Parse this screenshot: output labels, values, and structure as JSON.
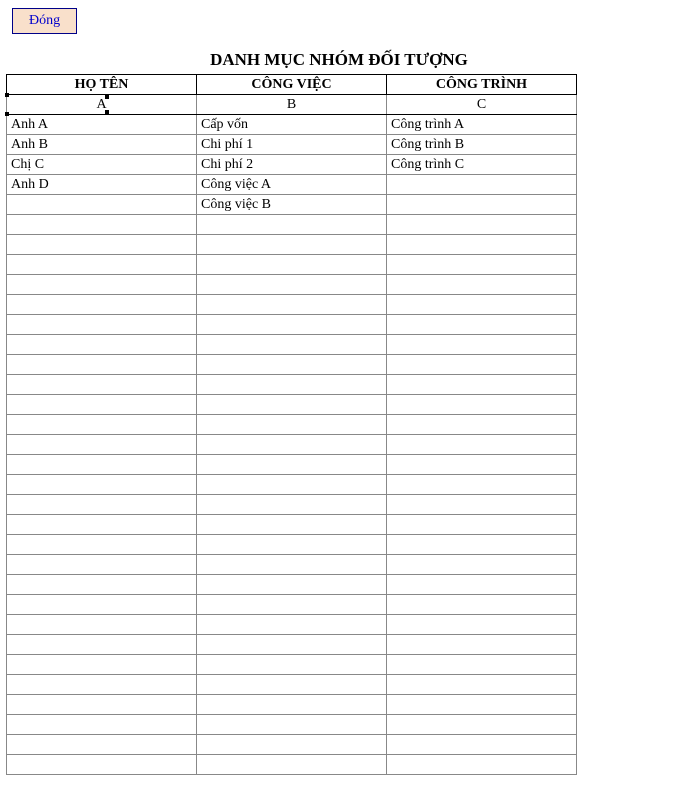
{
  "close_button_label": "Đóng",
  "title": "DANH MỤC NHÓM ĐỐI TƯỢNG",
  "columns": [
    {
      "header": "HỌ TÊN",
      "code": "A"
    },
    {
      "header": "CÔNG VIỆC",
      "code": "B"
    },
    {
      "header": "CÔNG TRÌNH",
      "code": "C"
    }
  ],
  "column_data": {
    "ho_ten": [
      "Anh A",
      "Anh B",
      "Chị C",
      "Anh D"
    ],
    "cong_viec": [
      "Cấp vốn",
      "Chi phí 1",
      "Chi phí 2",
      "Công việc A",
      "Công việc B"
    ],
    "cong_trinh": [
      "Công trình A",
      "Công trình B",
      "Công trình C"
    ]
  },
  "visible_rows": 33
}
